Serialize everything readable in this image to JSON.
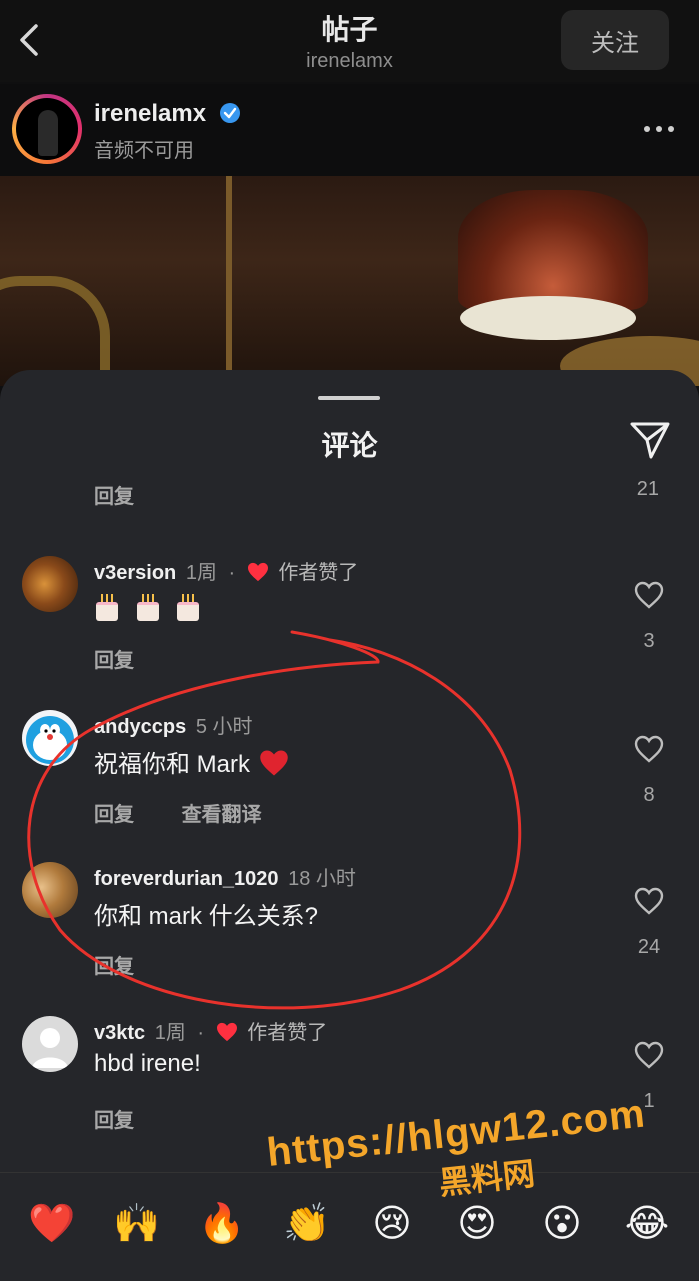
{
  "header": {
    "title": "帖子",
    "subtitle": "irenelamx",
    "follow_label": "关注"
  },
  "post": {
    "username": "irenelamx",
    "audio_status": "音频不可用"
  },
  "sheet": {
    "title": "评论",
    "reply_label": "回复",
    "top_count": "21"
  },
  "comments": [
    {
      "user": "v3ersion",
      "time": "1周",
      "liked_by_author": "作者赞了",
      "text": "",
      "actions": [
        "回复"
      ],
      "likes": "3"
    },
    {
      "user": "andyccps",
      "time": "5 小时",
      "text": "祝福你和 Mark",
      "actions": [
        "回复",
        "查看翻译"
      ],
      "likes": "8"
    },
    {
      "user": "foreverdurian_1020",
      "time": "18 小时",
      "text": "你和 mark 什么关系?",
      "actions": [
        "回复"
      ],
      "likes": "24"
    },
    {
      "user": "v3ktc",
      "time": "1周",
      "liked_by_author": "作者赞了",
      "text": "hbd irene!",
      "actions": [
        "回复"
      ],
      "likes": "1"
    }
  ],
  "emoji_bar": [
    "❤️",
    "🙌",
    "🔥",
    "👏",
    "😢",
    "😍",
    "😮",
    "😂"
  ],
  "watermark": {
    "url": "https://hlgw12.com",
    "name": "黑料网"
  },
  "colors": {
    "sheet_bg": "#25262a",
    "like_red": "#ff3040",
    "annotation_red": "#e8322c",
    "watermark": "#f4a62a"
  }
}
